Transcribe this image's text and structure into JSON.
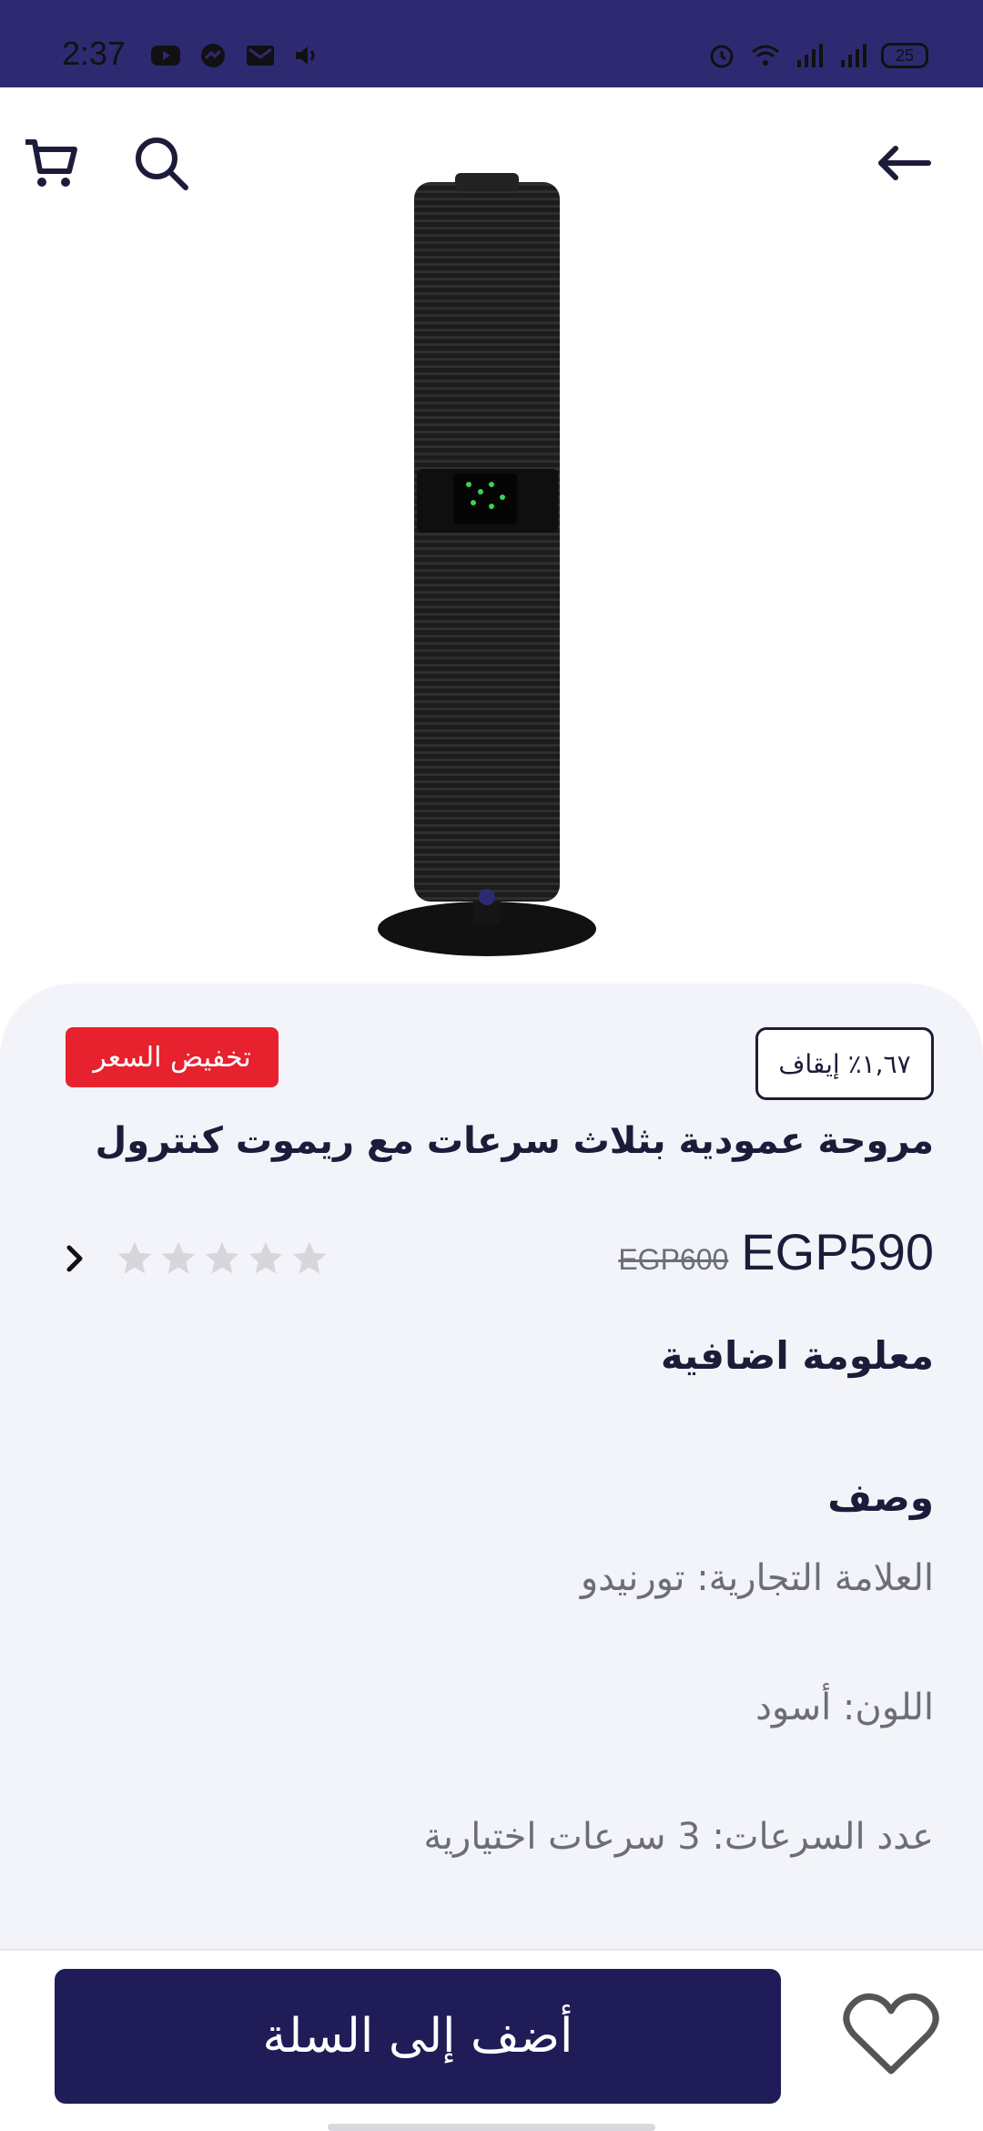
{
  "status_bar": {
    "time": "2:37",
    "battery": "25",
    "left_icons": [
      "youtube-icon",
      "messenger-icon",
      "gmail-icon",
      "volume-icon"
    ],
    "right_icons": [
      "alarm-icon",
      "wifi-icon",
      "signal-icon",
      "signal-icon"
    ]
  },
  "top_bar": {
    "icons": [
      "cart-icon",
      "search-icon",
      "back-arrow-icon"
    ]
  },
  "product": {
    "discount_text": "١,٦٧٪ إيقاف",
    "sale_badge": "تخفيض السعر",
    "title": "مروحة عمودية بثلاث سرعات مع ريموت كنترول",
    "price": "EGP590",
    "old_price": "EGP600",
    "rating": 0,
    "rating_max": 5
  },
  "sections": {
    "extra_info_heading": "معلومة اضافية",
    "description_heading": "وصف",
    "brand_line": "العلامة التجارية: تورنيدو",
    "color_line": "اللون: أسود",
    "speeds_line": "عدد السرعات: 3 سرعات اختيارية"
  },
  "bottom_bar": {
    "add_to_cart_label": "أضف إلى السلة"
  },
  "colors": {
    "status_bar": "#2d2a72",
    "primary": "#1f1c57",
    "sale_red": "#e8212e",
    "panel_bg": "#f3f4f9",
    "muted_text": "#6d6d7a",
    "star_empty": "#d6d6dc"
  }
}
